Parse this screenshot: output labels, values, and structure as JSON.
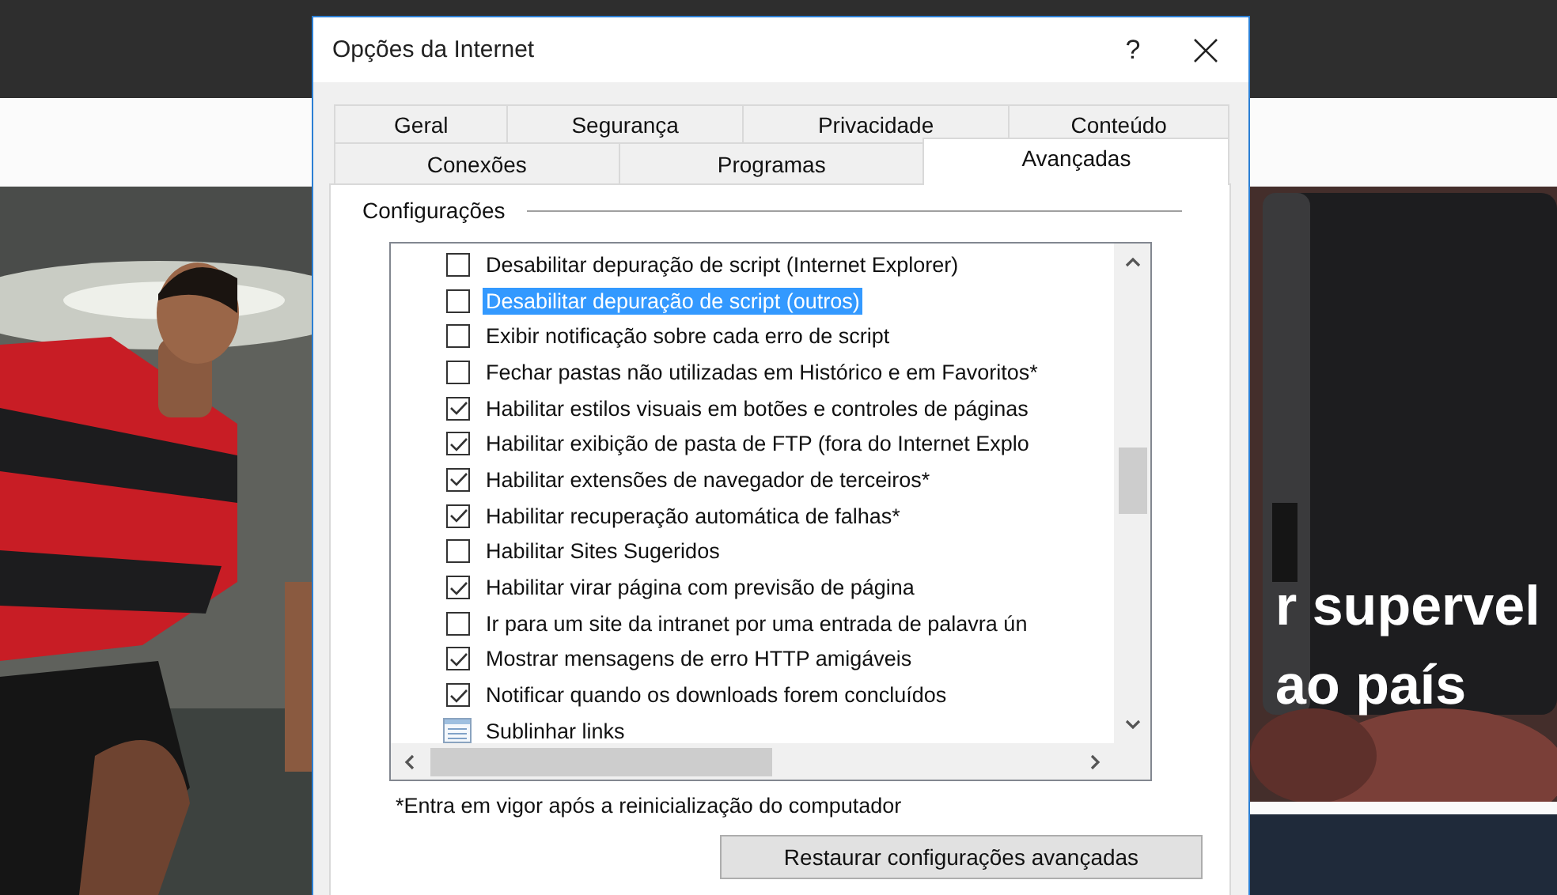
{
  "website": {
    "headline": [
      "r supervel",
      "ao país"
    ]
  },
  "dialog": {
    "title": "Opções da Internet",
    "help": "?",
    "tab_rows": [
      [
        {
          "label": "Geral",
          "selected": false
        },
        {
          "label": "Segurança",
          "selected": false
        },
        {
          "label": "Privacidade",
          "selected": false
        },
        {
          "label": "Conteúdo",
          "selected": false
        }
      ],
      [
        {
          "label": "Conexões",
          "selected": false
        },
        {
          "label": "Programas",
          "selected": false
        },
        {
          "label": "Avançadas",
          "selected": true
        }
      ]
    ],
    "section_label": "Configurações",
    "settings": [
      {
        "kind": "checkbox",
        "label": "Desabilitar depuração de script (Internet Explorer)",
        "checked": false,
        "selected": false
      },
      {
        "kind": "checkbox",
        "label": "Desabilitar depuração de script (outros)",
        "checked": false,
        "selected": true
      },
      {
        "kind": "checkbox",
        "label": "Exibir notificação sobre cada erro de script",
        "checked": false,
        "selected": false
      },
      {
        "kind": "checkbox",
        "label": "Fechar pastas não utilizadas em Histórico e em Favoritos*",
        "checked": false,
        "selected": false
      },
      {
        "kind": "checkbox",
        "label": "Habilitar estilos visuais em botões e controles de páginas",
        "checked": true,
        "selected": false
      },
      {
        "kind": "checkbox",
        "label": "Habilitar exibição de pasta de FTP (fora do Internet Explo",
        "checked": true,
        "selected": false
      },
      {
        "kind": "checkbox",
        "label": "Habilitar extensões de navegador de terceiros*",
        "checked": true,
        "selected": false
      },
      {
        "kind": "checkbox",
        "label": "Habilitar recuperação automática de falhas*",
        "checked": true,
        "selected": false
      },
      {
        "kind": "checkbox",
        "label": "Habilitar Sites Sugeridos",
        "checked": false,
        "selected": false
      },
      {
        "kind": "checkbox",
        "label": "Habilitar virar página com previsão de página",
        "checked": true,
        "selected": false
      },
      {
        "kind": "checkbox",
        "label": "Ir para um site da intranet por uma entrada de palavra ún",
        "checked": false,
        "selected": false
      },
      {
        "kind": "checkbox",
        "label": "Mostrar mensagens de erro HTTP amigáveis",
        "checked": true,
        "selected": false
      },
      {
        "kind": "checkbox",
        "label": "Notificar quando os downloads forem concluídos",
        "checked": true,
        "selected": false
      },
      {
        "kind": "group",
        "label": "Sublinhar links",
        "selected": false
      }
    ],
    "footnote": "*Entra em vigor após a reinicialização do computador",
    "buttons": [
      "Restaurar configurações avançadas"
    ]
  }
}
